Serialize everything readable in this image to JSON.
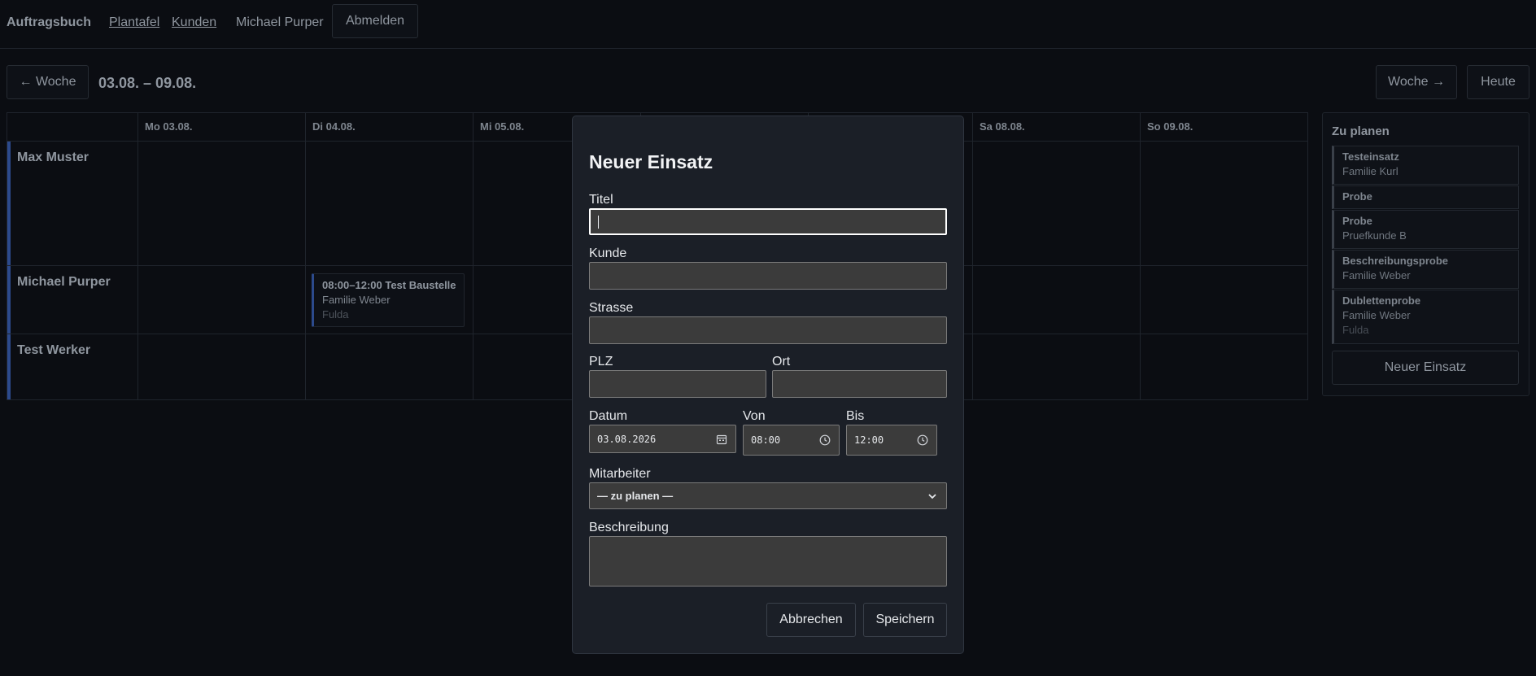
{
  "nav": {
    "brand": "Auftragsbuch",
    "links": [
      "Plantafel",
      "Kunden"
    ],
    "user": "Michael Purper",
    "logout": "Abmelden"
  },
  "week": {
    "prev": "← Woche",
    "range": "03.08. – 09.08.",
    "next": "Woche →",
    "today": "Heute"
  },
  "days": [
    "Mo 03.08.",
    "Di 04.08.",
    "Mi 05.08.",
    "",
    "",
    "Sa 08.08.",
    "So 09.08."
  ],
  "workers": [
    "Max Muster",
    "Michael Purper",
    "Test Werker"
  ],
  "event": {
    "title": "08:00–12:00 Test Baustelle",
    "customer": "Familie Weber",
    "city": "Fulda"
  },
  "sidebar": {
    "title": "Zu planen",
    "cards": [
      {
        "title": "Testeinsatz",
        "sub": "Familie Kurl",
        "dim": ""
      },
      {
        "title": "Probe",
        "sub": "",
        "dim": ""
      },
      {
        "title": "Probe",
        "sub": "Pruefkunde B",
        "dim": ""
      },
      {
        "title": "Beschreibungsprobe",
        "sub": "Familie Weber",
        "dim": ""
      },
      {
        "title": "Dublettenprobe",
        "sub": "Familie Weber",
        "dim": "Fulda"
      }
    ],
    "new_button": "Neuer Einsatz"
  },
  "modal": {
    "title": "Neuer Einsatz",
    "labels": {
      "titel": "Titel",
      "kunde": "Kunde",
      "strasse": "Strasse",
      "plz": "PLZ",
      "ort": "Ort",
      "datum": "Datum",
      "von": "Von",
      "bis": "Bis",
      "mitarbeiter": "Mitarbeiter",
      "beschreibung": "Beschreibung"
    },
    "values": {
      "titel": "",
      "kunde": "",
      "strasse": "",
      "plz": "",
      "ort": "",
      "datum": "03.08.2026",
      "von": "08:00",
      "bis": "12:00",
      "mitarbeiter": "— zu planen —",
      "beschreibung": ""
    },
    "cancel": "Abbrechen",
    "save": "Speichern"
  },
  "icons": {
    "calendar": "calendar-icon",
    "clock": "clock-icon",
    "dropdown": "chevron-down-icon"
  },
  "colors": {
    "background": "#0b0d12",
    "accent": "#2c4a8c",
    "modal": "#1b1f27",
    "field": "#3b3b3b"
  }
}
